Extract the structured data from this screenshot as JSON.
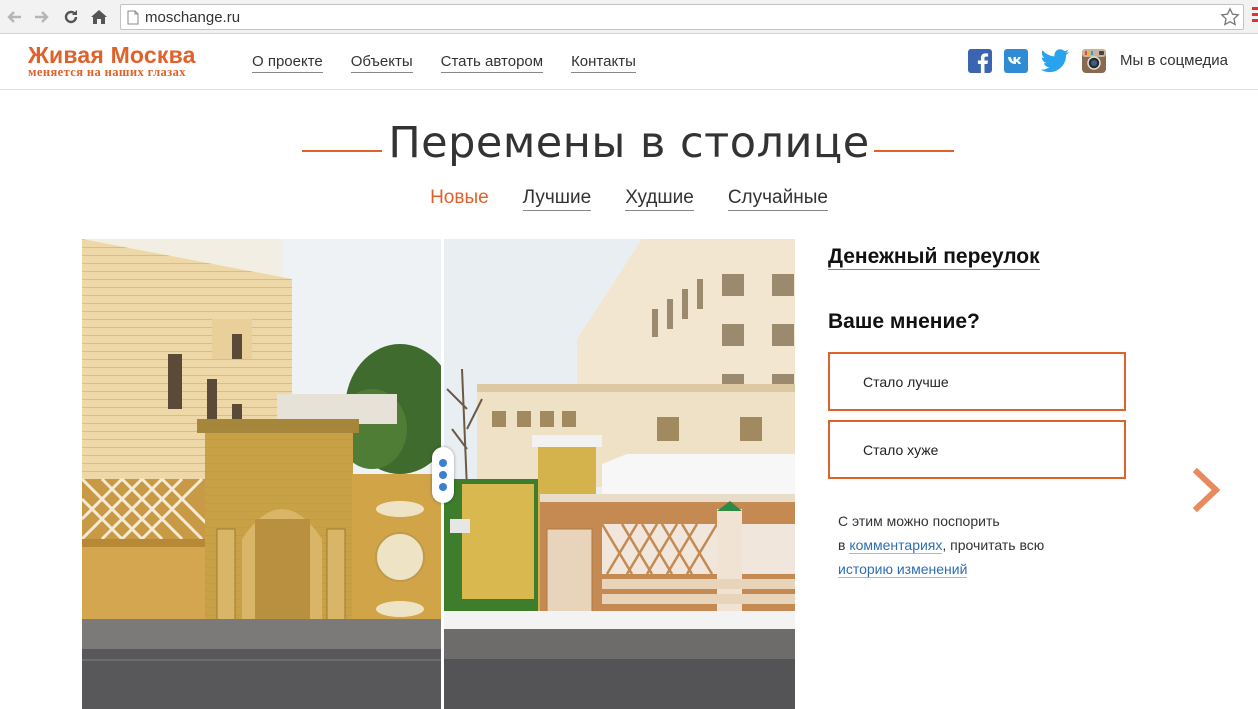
{
  "browser": {
    "url": "moschange.ru"
  },
  "header": {
    "logo_title": "Живая Москва",
    "logo_subtitle": "меняется на наших глазах",
    "nav": [
      {
        "label": "О проекте"
      },
      {
        "label": "Объекты"
      },
      {
        "label": "Стать автором"
      },
      {
        "label": "Контакты"
      }
    ],
    "social_icons": [
      "facebook-icon",
      "vk-icon",
      "twitter-icon",
      "instagram-icon"
    ],
    "social_label": "Мы в соцмедиа"
  },
  "main": {
    "title": "Перемены в столице",
    "filters": [
      {
        "label": "Новые",
        "active": true
      },
      {
        "label": "Лучшие",
        "active": false
      },
      {
        "label": "Худшие",
        "active": false
      },
      {
        "label": "Случайные",
        "active": false
      }
    ]
  },
  "panel": {
    "place_name": "Денежный переулок",
    "question": "Ваше мнение?",
    "vote_better": "Стало лучше",
    "vote_worse": "Стало хуже",
    "discuss_line1": "С этим можно поспорить",
    "discuss_prefix": "в ",
    "comments_link": "комментариях",
    "discuss_middle": ", прочитать всю",
    "history_link": "историю изменений"
  },
  "colors": {
    "accent": "#e0622a",
    "link": "#2c6fb4",
    "text": "#333333"
  }
}
